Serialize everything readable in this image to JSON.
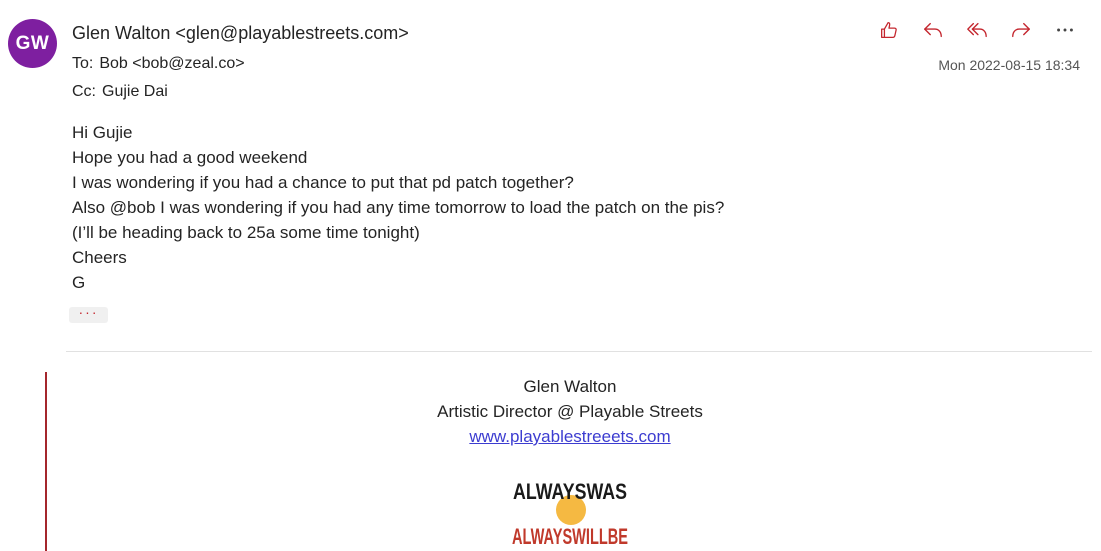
{
  "sender": {
    "initials": "GW",
    "display": "Glen Walton <glen@playablestreets.com>",
    "avatar_color": "#7e1fa0"
  },
  "to": {
    "label": "To:",
    "value": "Bob <bob@zeal.co>"
  },
  "cc": {
    "label": "Cc:",
    "value": "Gujie Dai"
  },
  "date": "Mon 2022-08-15 18:34",
  "actions": [
    {
      "icon": "like-icon"
    },
    {
      "icon": "reply-icon"
    },
    {
      "icon": "reply-all-icon"
    },
    {
      "icon": "forward-icon"
    },
    {
      "icon": "more-actions-icon"
    }
  ],
  "body_lines": [
    "Hi Gujie",
    "Hope you had a good weekend",
    "I was wondering if you had a chance to put that pd patch together?",
    "Also @bob I was wondering if you had any time tomorrow to load the patch on the pis?",
    "(I’ll be heading back to 25a some time tonight)",
    "Cheers",
    "G"
  ],
  "show_more": "···",
  "signature": {
    "name": "Glen Walton",
    "title": "Artistic Director @ Playable Streets",
    "link": "www.playablestreeets.com"
  },
  "logo": {
    "line1": "ALWAYS WAS",
    "line2": "ALWAYS WILL BE",
    "colors": {
      "black": "#1a1a1a",
      "red": "#c0392b",
      "sun": "#f5b942"
    }
  },
  "accent_color": "#c4262e"
}
